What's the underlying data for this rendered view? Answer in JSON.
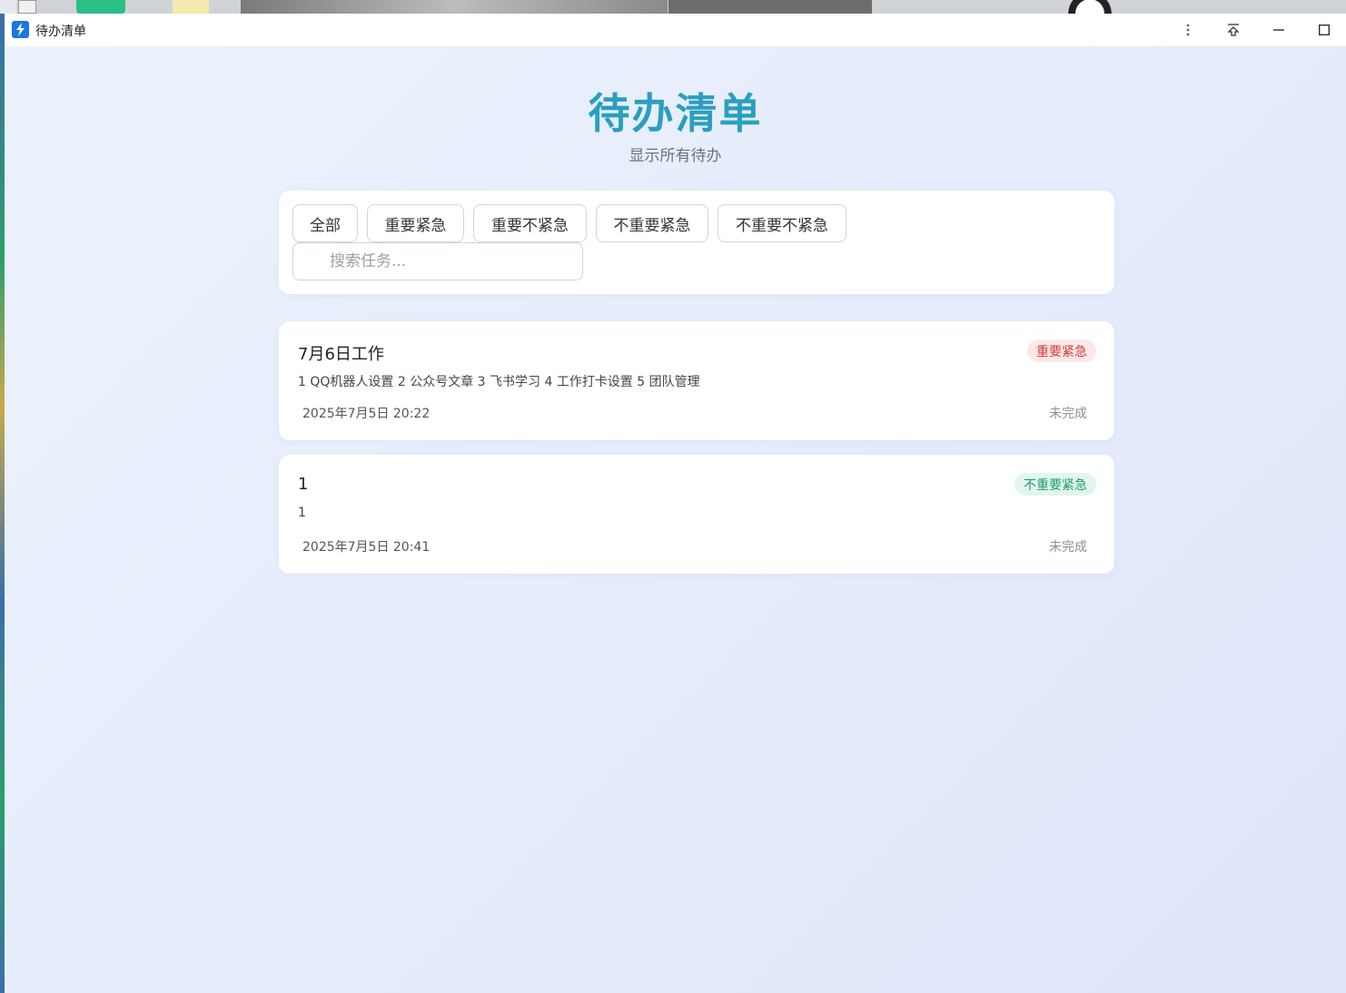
{
  "window": {
    "title": "待办清单"
  },
  "header": {
    "title": "待办清单",
    "subtitle": "显示所有待办"
  },
  "filters": {
    "buttons": [
      "全部",
      "重要紧急",
      "重要不紧急",
      "不重要紧急",
      "不重要不紧急"
    ],
    "search_placeholder": "搜索任务..."
  },
  "tasks": [
    {
      "title": "7月6日工作",
      "description": "1 QQ机器人设置 2 公众号文章 3 飞书学习 4 工作打卡设置 5 团队管理",
      "date": "2025年7月5日 20:22",
      "status": "未完成",
      "priority": "重要紧急",
      "priority_color": "#d93a3a"
    },
    {
      "title": "1",
      "description": "1",
      "date": "2025年7月5日 20:41",
      "status": "未完成",
      "priority": "不重要紧急",
      "priority_color": "#1e9e68"
    }
  ],
  "colors": {
    "title": "#2a9fc0",
    "app_icon": "#1677e5"
  }
}
